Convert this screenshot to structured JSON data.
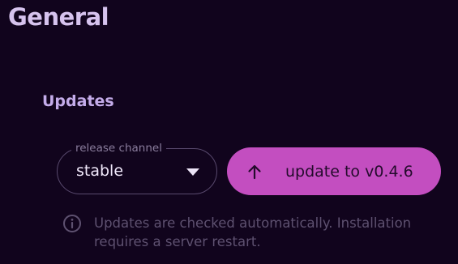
{
  "page": {
    "title": "General"
  },
  "updates": {
    "section_title": "Updates",
    "release_channel": {
      "label": "release channel",
      "value": "stable"
    },
    "update_button": {
      "label": "update to v0.4.6",
      "icon": "arrow-up-icon"
    },
    "info": {
      "icon": "info-icon",
      "text": "Updates are checked automatically. Installation requires a server restart."
    }
  },
  "colors": {
    "background": "#11041d",
    "title": "#d6c3ee",
    "section_title": "#c4acea",
    "accent": "#c34ec0",
    "muted_text": "#5e5170"
  }
}
